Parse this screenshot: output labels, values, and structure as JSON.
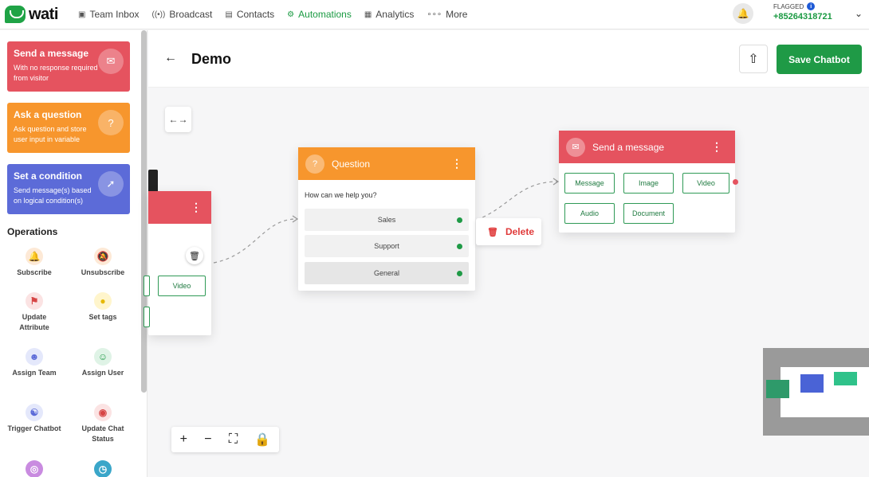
{
  "app": {
    "logo_text": "wati"
  },
  "nav": {
    "items": [
      {
        "label": "Team Inbox",
        "icon": "inbox-icon"
      },
      {
        "label": "Broadcast",
        "icon": "broadcast-icon"
      },
      {
        "label": "Contacts",
        "icon": "contacts-icon"
      },
      {
        "label": "Automations",
        "icon": "automations-icon",
        "active": true
      },
      {
        "label": "Analytics",
        "icon": "analytics-icon"
      },
      {
        "label": "More",
        "icon": "more-icon"
      }
    ]
  },
  "account": {
    "flag_label": "FLAGGED",
    "phone": "+85264318721"
  },
  "page": {
    "title": "Demo",
    "save_label": "Save Chatbot"
  },
  "sidebar": {
    "blocks": [
      {
        "title": "Send a message",
        "desc": "With no response required from visitor",
        "color": "#e5535f"
      },
      {
        "title": "Ask a question",
        "desc": "Ask question and store user input in variable",
        "color": "#f7962d"
      },
      {
        "title": "Set a condition",
        "desc": "Send message(s) based on logical condition(s)",
        "color": "#5c6bd8"
      }
    ],
    "operations_title": "Operations",
    "operations": [
      {
        "label": "Subscribe",
        "icon": "bell-icon"
      },
      {
        "label": "Unsubscribe",
        "icon": "bell-off-icon"
      },
      {
        "label": "Update Attribute",
        "icon": "tag-icon"
      },
      {
        "label": "Set tags",
        "icon": "lightbulb-icon"
      },
      {
        "label": "Assign Team",
        "icon": "team-icon"
      },
      {
        "label": "Assign User",
        "icon": "user-add-icon"
      },
      {
        "label": "Trigger Chatbot",
        "icon": "chatbot-icon"
      },
      {
        "label": "Update Chat Status",
        "icon": "chat-status-icon"
      }
    ]
  },
  "question_node": {
    "title": "Question",
    "prompt": "How can we help you?",
    "options": [
      "Sales",
      "Support",
      "General"
    ]
  },
  "message_node": {
    "title": "Send a message",
    "buttons": [
      "Message",
      "Image",
      "Video",
      "Audio",
      "Document"
    ]
  },
  "left_node": {
    "button": "Video"
  },
  "delete_popup": {
    "label": "Delete"
  }
}
